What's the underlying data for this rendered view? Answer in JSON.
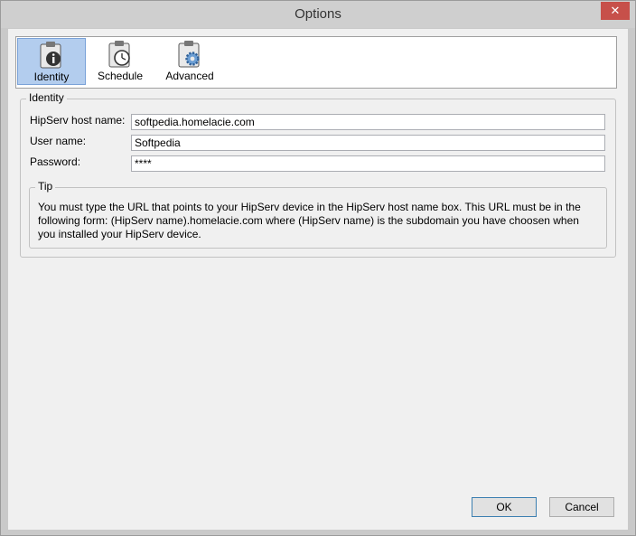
{
  "window": {
    "title": "Options",
    "close_glyph": "✕"
  },
  "toolbar": {
    "items": [
      {
        "label": "Identity",
        "icon": "clipboard-info-icon",
        "selected": true
      },
      {
        "label": "Schedule",
        "icon": "clipboard-clock-icon",
        "selected": false
      },
      {
        "label": "Advanced",
        "icon": "clipboard-gear-icon",
        "selected": false
      }
    ]
  },
  "identity": {
    "group_title": "Identity",
    "host_label": "HipServ host name:",
    "host_value": "softpedia.homelacie.com",
    "user_label": "User name:",
    "user_value": "Softpedia",
    "password_label": "Password:",
    "password_value": "****"
  },
  "tip": {
    "title": "Tip",
    "text": "You must type the URL that points to your HipServ device in the HipServ host name box. This URL must be in the following form: (HipServ name).homelacie.com where (HipServ name) is the subdomain you have choosen when you installed your HipServ device."
  },
  "buttons": {
    "ok": "OK",
    "cancel": "Cancel"
  },
  "colors": {
    "selected_tab": "#b3cdee",
    "close_button": "#c7504a"
  }
}
